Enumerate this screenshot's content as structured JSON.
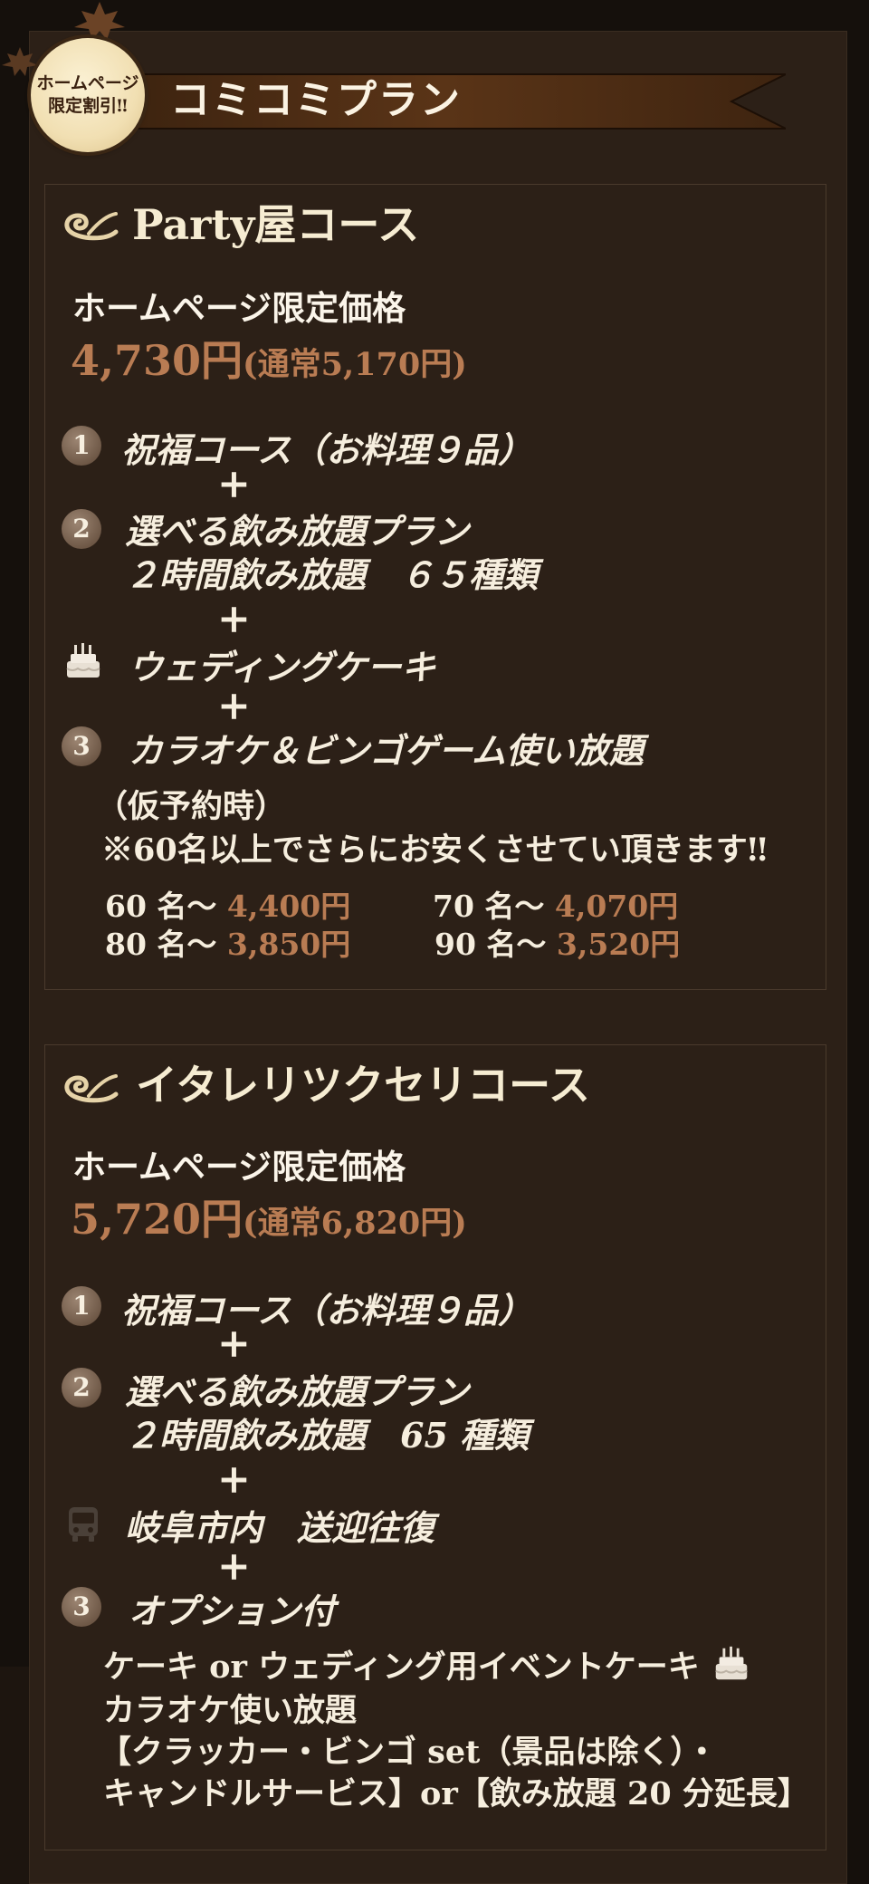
{
  "header": {
    "badge_line1": "ホームページ",
    "badge_line2": "限定割引‼",
    "title": "コミコミプラン"
  },
  "course1": {
    "title": "Party屋コース",
    "price_label": "ホームページ限定価格",
    "price": "4,730円",
    "price_normal": "(通常5,170円)",
    "num1": "1",
    "item1": "祝福コース（お料理９品）",
    "plus": "+",
    "num2": "2",
    "item2_line1": "選べる飲み放題プラン",
    "item2_line2": "２時間飲み放題　６５種類",
    "item_cake": "ウェディングケーキ",
    "num3": "3",
    "item3": "カラオケ＆ビンゴゲーム使い放題",
    "note1": "（仮予約時）",
    "note2": "※60名以上でさらにお安くさせてい頂きます‼",
    "tiers": [
      {
        "people": "60 名〜",
        "price": "4,400円"
      },
      {
        "people": "70 名〜",
        "price": "4,070円"
      },
      {
        "people": "80 名〜",
        "price": "3,850円"
      },
      {
        "people": "90 名〜",
        "price": "3,520円"
      }
    ]
  },
  "course2": {
    "title": "イタレリツクセリコース",
    "price_label": "ホームページ限定価格",
    "price": "5,720円",
    "price_normal": "(通常6,820円)",
    "num1": "1",
    "item1": "祝福コース（お料理９品）",
    "plus": "+",
    "num2": "2",
    "item2_line1": "選べる飲み放題プラン",
    "item2_line2": "２時間飲み放題　65 種類",
    "item_bus": "岐阜市内　送迎往復",
    "num3": "3",
    "item3": "オプション付",
    "detail1": "ケーキ or ウェディング用イベントケーキ",
    "detail2": "カラオケ使い放題",
    "detail3": "【クラッカー・ビンゴ set（景品は除く）・",
    "detail4": "キャンドルサービス】or【飲み放題 20 分延長】"
  },
  "icons": {
    "swirl": "swirl-ornament-icon",
    "cake": "cake-icon",
    "bus": "bus-icon",
    "leaf": "maple-leaf-icon"
  },
  "colors": {
    "background": "#2c2017",
    "outer": "#15100c",
    "price": "#b97c53",
    "text": "#f6eede",
    "badge": "#f1dfb2"
  }
}
